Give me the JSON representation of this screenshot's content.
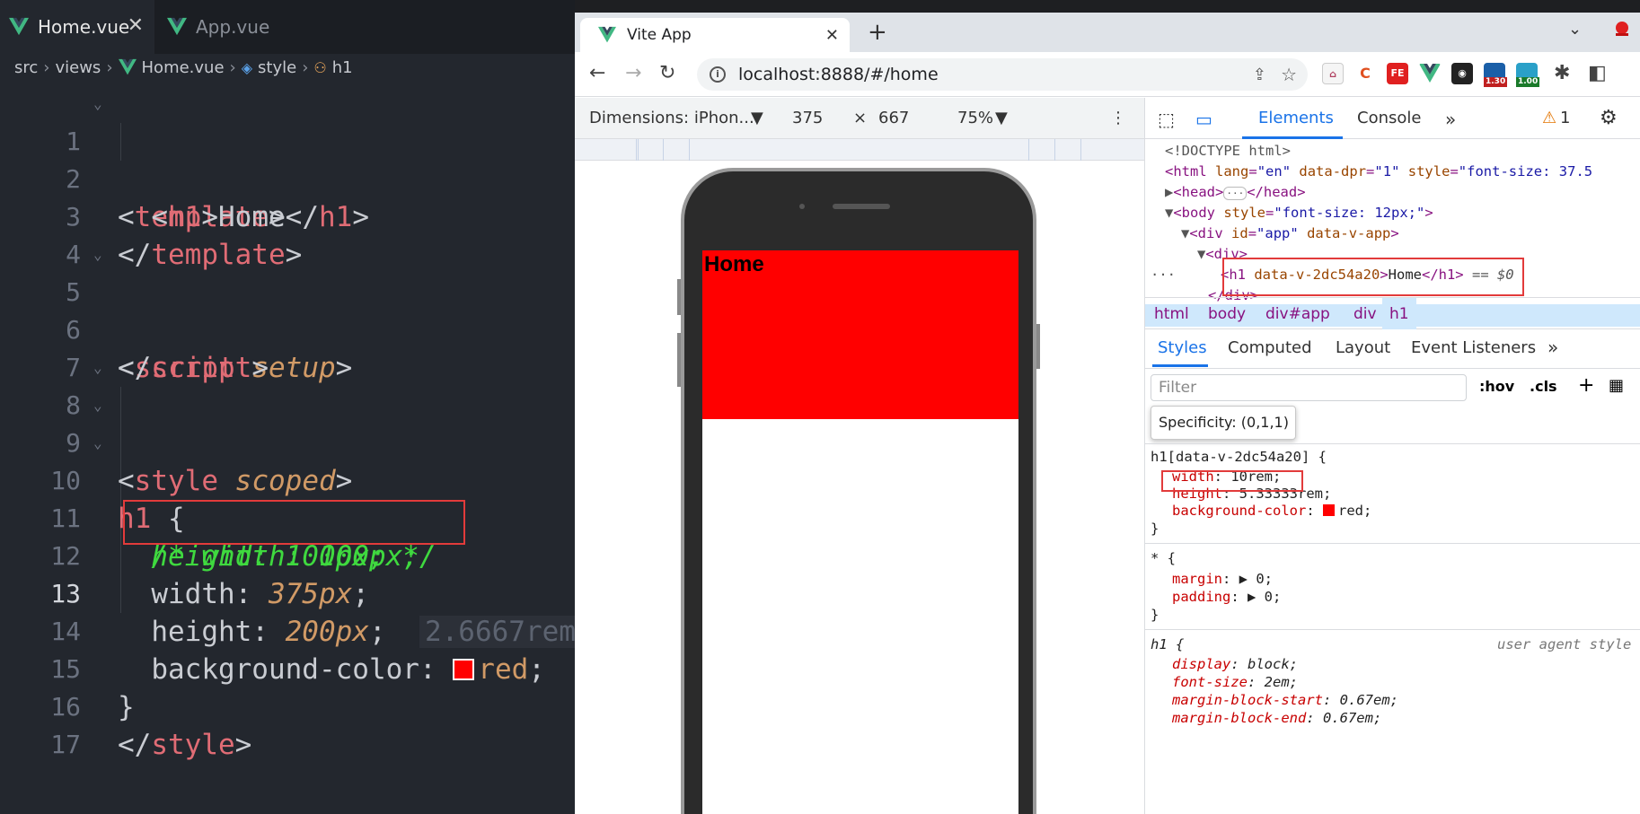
{
  "editor": {
    "tabs": [
      {
        "label": "Home.vue",
        "active": true
      },
      {
        "label": "App.vue",
        "active": false
      }
    ],
    "breadcrumb": [
      "src",
      "views",
      "Home.vue",
      "style",
      "h1"
    ],
    "line_numbers": [
      "1",
      "2",
      "3",
      "4",
      "5",
      "6",
      "7",
      "8",
      "9",
      "10",
      "11",
      "12",
      "13",
      "14",
      "15",
      "16",
      "17"
    ],
    "code": {
      "l1_tag": "template",
      "l2_open": "h1",
      "l2_text": "Home",
      "l2_close": "h1",
      "l3_tag": "template",
      "l5_tag": "script",
      "l5_attr": "setup",
      "l6_tag": "script",
      "l8_tag": "style",
      "l8_attr": "scoped",
      "l9_sel": "h1",
      "l10_comment": "/* width: 100px;",
      "l11_comment": "height: 100px; */",
      "l12_prop": "width",
      "l12_val": "375px",
      "l13_prop": "height",
      "l13_val": "200px",
      "l13_hint": "2.6667rem",
      "l14_prop": "background-color",
      "l14_val": "red",
      "l15_brace": "}",
      "l16_tag": "style"
    },
    "colors": {
      "tag": "#e06c75",
      "comment": "#3fd93f",
      "value": "#d19a66",
      "highlight": "#e23b3b"
    }
  },
  "browser": {
    "tab_title": "Vite App",
    "url": "localhost:8888/#/home",
    "extension_badges": [
      "1.30",
      "1.00"
    ],
    "device": {
      "name": "Dimensions: iPhon...",
      "width": "375",
      "x": "×",
      "height": "667",
      "zoom": "75%"
    },
    "page": {
      "heading": "Home",
      "box_color": "#ff0000"
    }
  },
  "devtools": {
    "tabs": [
      "Elements",
      "Console"
    ],
    "warnings": "1",
    "dom": {
      "doctype": "<!DOCTYPE html>",
      "html_lang": "en",
      "html_dpr": "1",
      "html_style": "font-size: 37.5",
      "body_style": "font-size: 12px;",
      "app_id": "app",
      "app_attr": "data-v-app",
      "h1_attr": "data-v-2dc54a20",
      "h1_text": "Home",
      "h1_ref": "== $0"
    },
    "crumbs": [
      "html",
      "body",
      "div#app",
      "div",
      "h1"
    ],
    "subtabs": [
      "Styles",
      "Computed",
      "Layout",
      "Event Listeners"
    ],
    "filter_placeholder": "Filter",
    "hov": ":hov",
    "cls": ".cls",
    "tooltip": "Specificity: (0,1,1)",
    "rules": {
      "r1_selector": "h1[data-v-2dc54a20] {",
      "r1_p1": "width",
      "r1_v1": "10rem;",
      "r1_p2": "height",
      "r1_v2": "5.33333rem;",
      "r1_p3": "background-color",
      "r1_v3": "red;",
      "r2_selector": "* {",
      "r2_p1": "margin",
      "r2_v1": "0;",
      "r2_p2": "padding",
      "r2_v2": "0;",
      "r3_selector": "h1 {",
      "r3_source": "user agent style",
      "r3_p1": "display",
      "r3_v1": "block;",
      "r3_p2": "font-size",
      "r3_v2": "2em;",
      "r3_p3": "margin-block-start",
      "r3_v3": "0.67em;",
      "r3_p4": "margin-block-end",
      "r3_v4": "0.67em;",
      "close": "}"
    }
  }
}
